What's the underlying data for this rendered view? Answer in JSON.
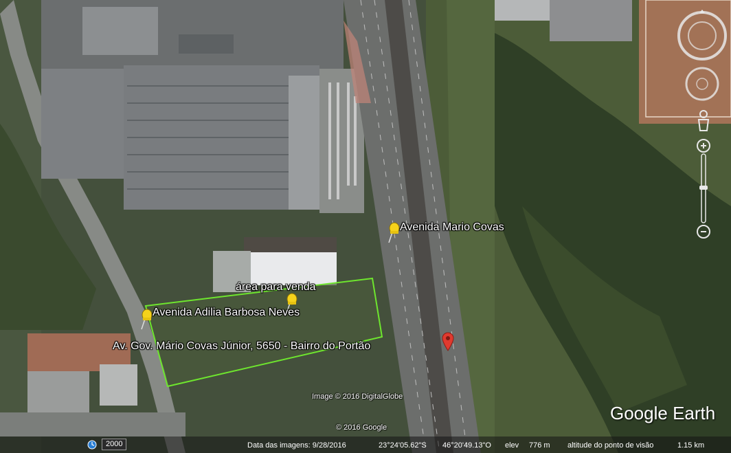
{
  "placemarks": {
    "mario_covas_label": "Avenida Mario Covas",
    "area_label": "área para venda",
    "adilia_label": "Avenida Adilia Barbosa Neves",
    "address_label": "Av. Gov. Mário Covas Júnior, 5650 - Bairro do Portão"
  },
  "attribution": {
    "imagery": "Image © 2016 DigitalGlobe",
    "copyright": "© 2016 Google"
  },
  "brand": "Google Earth",
  "statusbar": {
    "year": "2000",
    "imagery_date": "Data das imagens: 9/28/2016",
    "latitude": "23°24'05.62\"S",
    "longitude": "46°20'49.13\"O",
    "elev_label": "elev",
    "elevation": "776 m",
    "eye_alt_label": "altitude do ponto de visão",
    "eye_alt": "1.15 km"
  },
  "colors": {
    "polygon_outline": "#6ee62e",
    "pin_yellow": "#f5d21b",
    "marker_red": "#e03a2f"
  },
  "icons": [
    "yellow-pushpin-icon",
    "red-location-marker-icon",
    "compass-ring-icon",
    "look-joystick-icon",
    "street-view-person-icon",
    "zoom-slider-icon",
    "historical-imagery-clock-icon"
  ]
}
